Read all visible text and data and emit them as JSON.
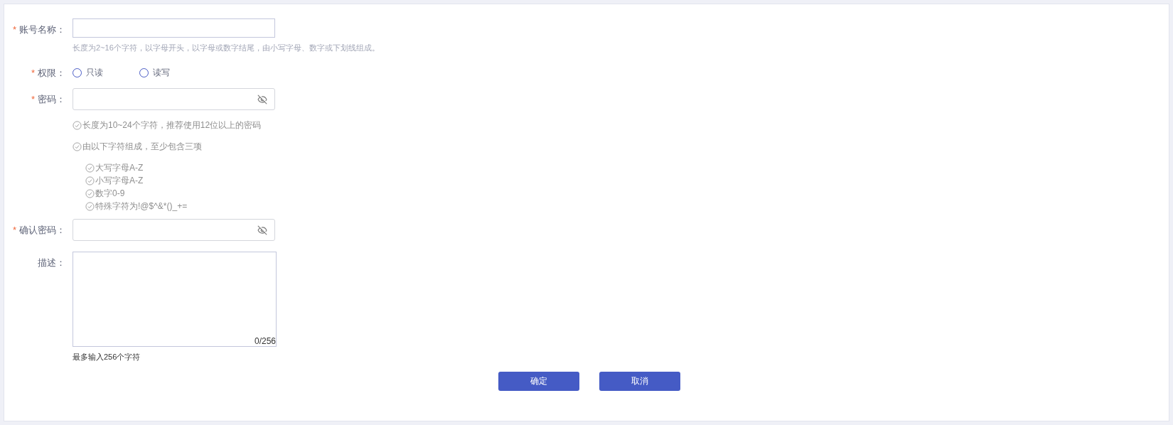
{
  "form": {
    "account": {
      "required_mark": "*",
      "label": "账号名称：",
      "hint": "长度为2~16个字符，以字母开头，以字母或数字结尾，由小写字母、数字或下划线组成。"
    },
    "permission": {
      "required_mark": "*",
      "label": "权限：",
      "options": [
        {
          "label": "只读",
          "selected": false
        },
        {
          "label": "读写",
          "selected": false
        }
      ]
    },
    "password": {
      "required_mark": "*",
      "label": "密码：",
      "rules": [
        {
          "text": "长度为10~24个字符，推荐使用12位以上的密码"
        },
        {
          "text": "由以下字符组成，至少包含三项",
          "children": [
            {
              "text": "大写字母A-Z"
            },
            {
              "text": "小写字母A-Z"
            },
            {
              "text": "数字0-9"
            },
            {
              "text": "特殊字符为!@$^&*()_+="
            }
          ]
        }
      ]
    },
    "confirm_password": {
      "required_mark": "*",
      "label": "确认密码："
    },
    "description": {
      "label": "描述：",
      "counter": "0/256",
      "hint": "最多输入256个字符"
    },
    "buttons": [
      "确定",
      "取消"
    ]
  }
}
